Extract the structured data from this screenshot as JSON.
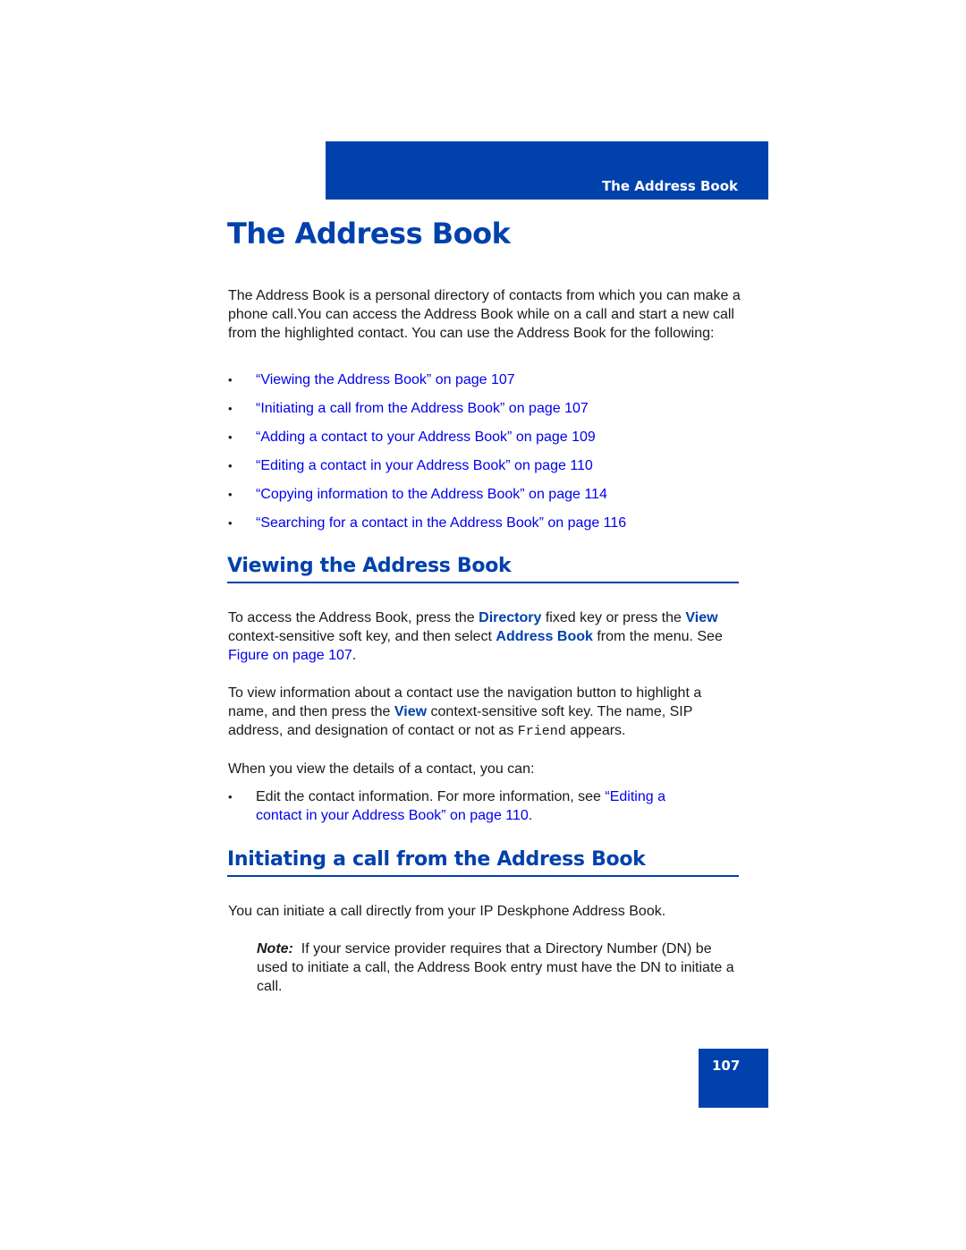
{
  "header": {
    "running_title": "The Address Book"
  },
  "page_title": "The Address Book",
  "intro": {
    "paragraph": "The Address Book is a personal directory of contacts from which you can make a phone call.You can access the Address Book while on a call and start a new call from the highlighted contact. You can use the Address Book for the following:",
    "links": [
      "“Viewing the Address Book” on page 107",
      "“Initiating a call from the Address Book” on page 107",
      "“Adding a contact to your Address Book” on page 109",
      "“Editing a contact in your Address Book” on page 110",
      "“Copying information to the Address Book” on page 114",
      "“Searching for a contact in the Address Book” on page 116"
    ],
    "bullet_glyph": "•"
  },
  "viewing": {
    "heading": "Viewing the Address Book",
    "p1": {
      "t1": "To access the Address Book, press the ",
      "k1": "Directory",
      "t2": " fixed key or press the ",
      "k2": "View",
      "t3": " context-sensitive soft key, and then select ",
      "k3": "Address Book",
      "t4": " from the menu. See ",
      "link": "Figure  on page 107",
      "t5": "."
    },
    "p2": {
      "t1": "To view information about a contact use the navigation button to highlight a name, and then press the ",
      "k1": "View",
      "t2": " context-sensitive soft key. The name, SIP address, and designation of contact or not as ",
      "mono": "Friend",
      "t3": " appears."
    },
    "p3": "When you view the details of a contact, you can:",
    "bullet": {
      "text": "Edit the contact information. For more information, see ",
      "link": "“Editing a contact in your Address Book” on page 110",
      "end": "."
    }
  },
  "initiating": {
    "heading": "Initiating a call from the Address Book",
    "p1": "You can initiate a call directly from your IP Deskphone Address Book.",
    "note_label": "Note:",
    "note_text": "  If your service provider requires that a Directory Number (DN) be used to initiate a call, the Address Book entry must have the DN to initiate a call."
  },
  "footer": {
    "page_number": "107"
  },
  "colors": {
    "brand_blue": "#0041ac",
    "link_blue": "#0000ee",
    "text": "#1a1a1a"
  }
}
